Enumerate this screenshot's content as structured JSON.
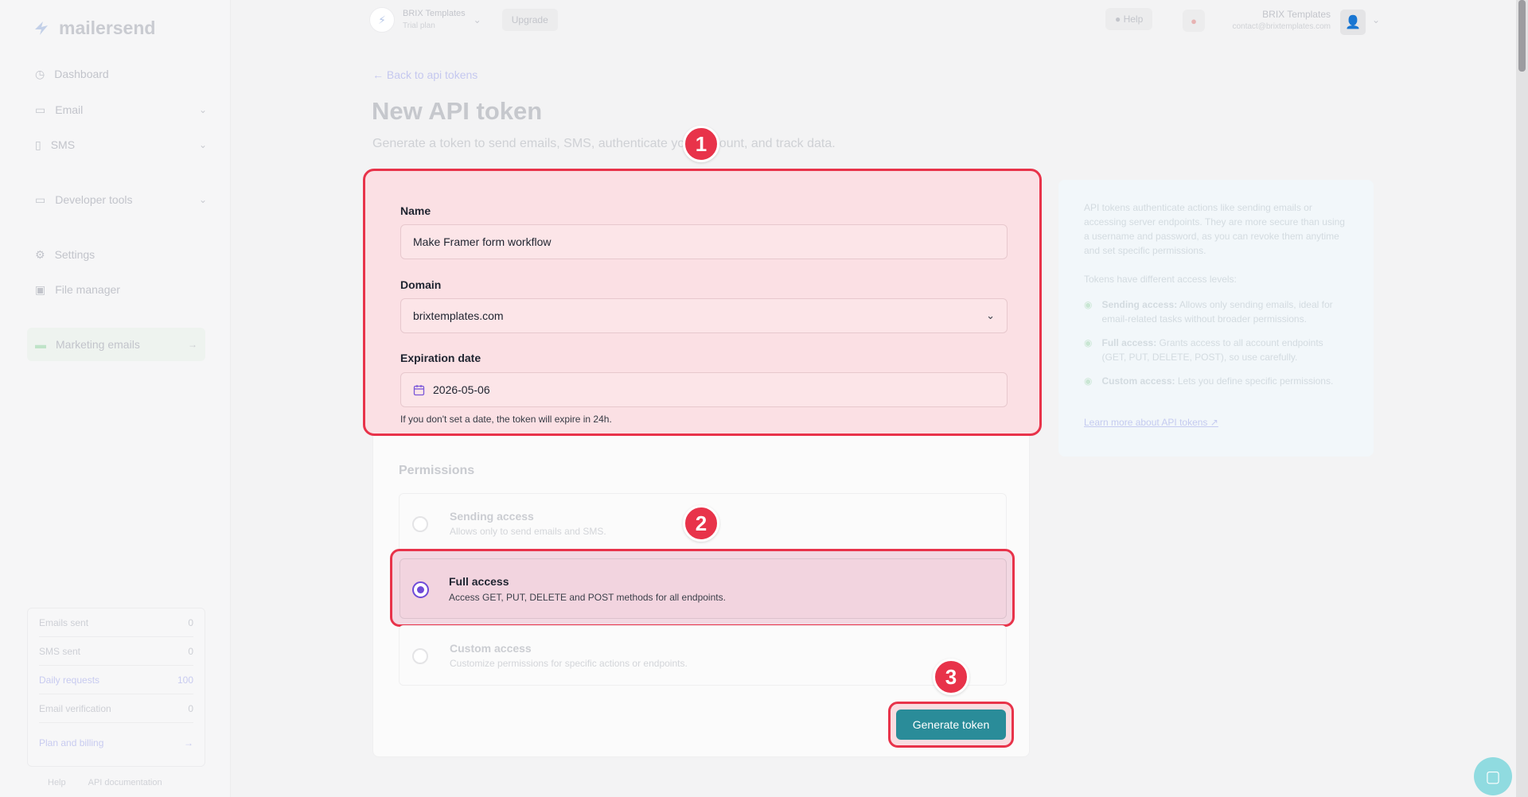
{
  "app": {
    "brand": "mailersend"
  },
  "sidebar": {
    "items": [
      {
        "label": "Dashboard",
        "icon": "clock-icon"
      },
      {
        "label": "Email",
        "icon": "mail-icon"
      },
      {
        "label": "SMS",
        "icon": "phone-icon"
      },
      {
        "label": "Developer tools",
        "icon": "code-icon"
      },
      {
        "label": "Settings",
        "icon": "gear-icon"
      },
      {
        "label": "File manager",
        "icon": "folder-icon"
      },
      {
        "label": "Marketing emails",
        "icon": "megaphone-icon"
      }
    ],
    "usage": [
      {
        "label": "Emails sent",
        "value": "0"
      },
      {
        "label": "SMS sent",
        "value": "0"
      },
      {
        "label": "Daily requests",
        "value": "100"
      },
      {
        "label": "Email verification",
        "value": "0"
      }
    ],
    "plan_link": "Plan and billing",
    "footer_help": "Help",
    "footer_docs": "API documentation"
  },
  "topbar": {
    "workspace_name": "BRIX Templates",
    "workspace_plan": "Trial plan",
    "upgrade": "Upgrade",
    "help": "Help",
    "account_name": "BRIX Templates",
    "account_email": "contact@brixtemplates.com"
  },
  "page": {
    "back_link": "Back to api tokens",
    "title": "New API token",
    "subtitle": "Generate a token to send emails, SMS, authenticate your account, and track data."
  },
  "form": {
    "name_label": "Name",
    "name_value": "Make Framer form workflow",
    "domain_label": "Domain",
    "domain_value": "brixtemplates.com",
    "expiration_label": "Expiration date",
    "expiration_value": "2026-05-06",
    "expiration_hint": "If you don't set a date, the token will expire in 24h."
  },
  "permissions": {
    "title": "Permissions",
    "options": [
      {
        "title": "Sending access",
        "desc": "Allows only to send emails and SMS."
      },
      {
        "title": "Full access",
        "desc": "Access GET, PUT, DELETE and POST methods for all endpoints."
      },
      {
        "title": "Custom access",
        "desc": "Customize permissions for specific actions or endpoints."
      }
    ],
    "selected": "Full access"
  },
  "actions": {
    "generate": "Generate token"
  },
  "info": {
    "intro": "API tokens authenticate actions like sending emails or accessing server endpoints. They are more secure than using a username and password, as you can revoke them anytime and set specific permissions.",
    "levels_intro": "Tokens have different access levels:",
    "levels": [
      {
        "name": "Sending access:",
        "desc": "Allows only sending emails, ideal for email-related tasks without broader permissions."
      },
      {
        "name": "Full access:",
        "desc": "Grants access to all account endpoints (GET, PUT, DELETE, POST), so use carefully."
      },
      {
        "name": "Custom access:",
        "desc": "Lets you define specific permissions."
      }
    ],
    "link": "Learn more about API tokens ↗"
  },
  "steps": [
    "1",
    "2",
    "3"
  ],
  "colors": {
    "highlight": "#e8334a",
    "primary_button": "#2a8c99",
    "radio_selected": "#6f4bd8"
  }
}
